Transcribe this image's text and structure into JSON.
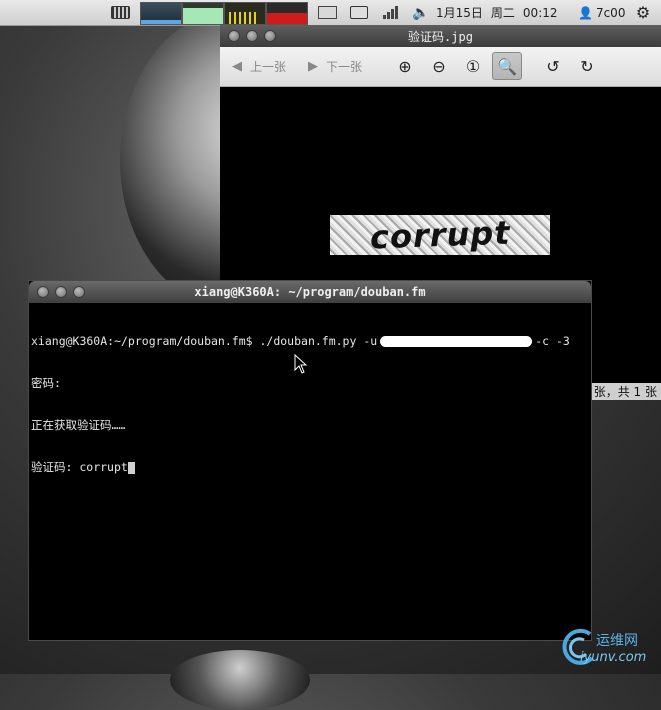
{
  "panel": {
    "date": "1月15日",
    "weekday": "周二",
    "time": "00:12",
    "user": "7c00"
  },
  "viewer": {
    "title": "验证码.jpg",
    "prev_label": "上一张",
    "next_label": "下一张",
    "image_text": "corrupt",
    "status": "张，共 1 张"
  },
  "terminal": {
    "title": "xiang@K360A: ~/program/douban.fm",
    "command_prefix": "xiang@K360A:~/program/douban.fm$ ./douban.fm.py -u",
    "command_suffix": "-c -3",
    "line2": "密码:",
    "line3": "正在获取验证码……",
    "line4": "验证码: corrupt"
  },
  "watermark": {
    "name": "运维网",
    "url": "iyunv.com"
  }
}
